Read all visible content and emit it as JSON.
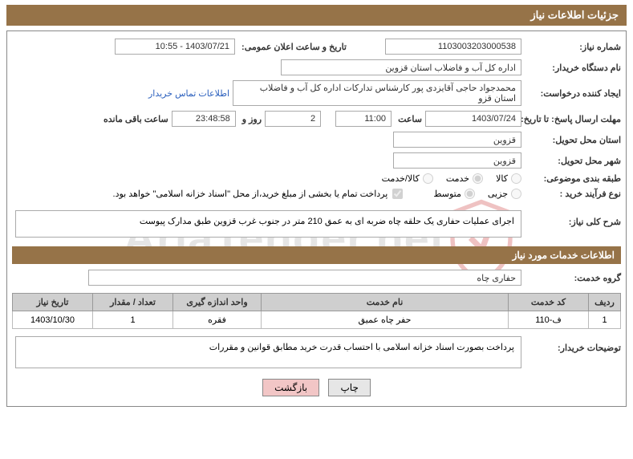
{
  "page_title": "جزئیات اطلاعات نیاز",
  "fields": {
    "need_number_label": "شماره نیاز:",
    "need_number": "1103003203000538",
    "announce_datetime_label": "تاریخ و ساعت اعلان عمومی:",
    "announce_datetime": "1403/07/21 - 10:55",
    "buyer_org_label": "نام دستگاه خریدار:",
    "buyer_org": "اداره کل آب و فاضلاب استان قزوین",
    "requester_label": "ایجاد کننده درخواست:",
    "requester": "محمدجواد حاجی آقایزدی پور کارشناس تدارکات اداره کل آب و فاضلاب استان قزو",
    "contact_link": "اطلاعات تماس خریدار",
    "deadline_label": "مهلت ارسال پاسخ: تا تاریخ:",
    "deadline_date": "1403/07/24",
    "time_label": "ساعت",
    "deadline_time": "11:00",
    "remaining_days": "2",
    "days_and": "روز و",
    "remaining_time": "23:48:58",
    "remaining_label": "ساعت باقی مانده",
    "delivery_province_label": "استان محل تحویل:",
    "delivery_province": "قزوین",
    "delivery_city_label": "شهر محل تحویل:",
    "delivery_city": "قزوین",
    "subject_class_label": "طبقه بندی موضوعی:",
    "subject_opt1": "کالا",
    "subject_opt2": "خدمت",
    "subject_opt3": "کالا/خدمت",
    "purchase_type_label": "نوع فرآیند خرید :",
    "purchase_opt1": "جزیی",
    "purchase_opt2": "متوسط",
    "islamic_treasury_note": "پرداخت تمام یا بخشی از مبلغ خرید،از محل \"اسناد خزانه اسلامی\" خواهد بود.",
    "need_summary_label": "شرح کلی نیاز:",
    "need_summary": "اجرای عملیات حفاری یک حلقه چاه ضربه ای به عمق 210 متر  در  جنوب  غرب قزوین طبق مدارک پیوست",
    "services_header": "اطلاعات خدمات مورد نیاز",
    "service_group_label": "گروه خدمت:",
    "service_group": "حفاری چاه",
    "buyer_note_label": "توضیحات خریدار:",
    "buyer_note": "پرداخت بصورت اسناد خزانه اسلامی با احتساب قدرت خرید مطابق قوانین و مقررات"
  },
  "table": {
    "headers": {
      "row": "ردیف",
      "code": "کد خدمت",
      "name": "نام خدمت",
      "unit": "واحد اندازه گیری",
      "qty": "تعداد / مقدار",
      "date": "تاریخ نیاز"
    },
    "rows": [
      {
        "row": "1",
        "code": "ف-110",
        "name": "حفر چاه عمیق",
        "unit": "فقره",
        "qty": "1",
        "date": "1403/10/30"
      }
    ]
  },
  "buttons": {
    "print": "چاپ",
    "back": "بازگشت"
  },
  "watermark": "AriaTender.net"
}
